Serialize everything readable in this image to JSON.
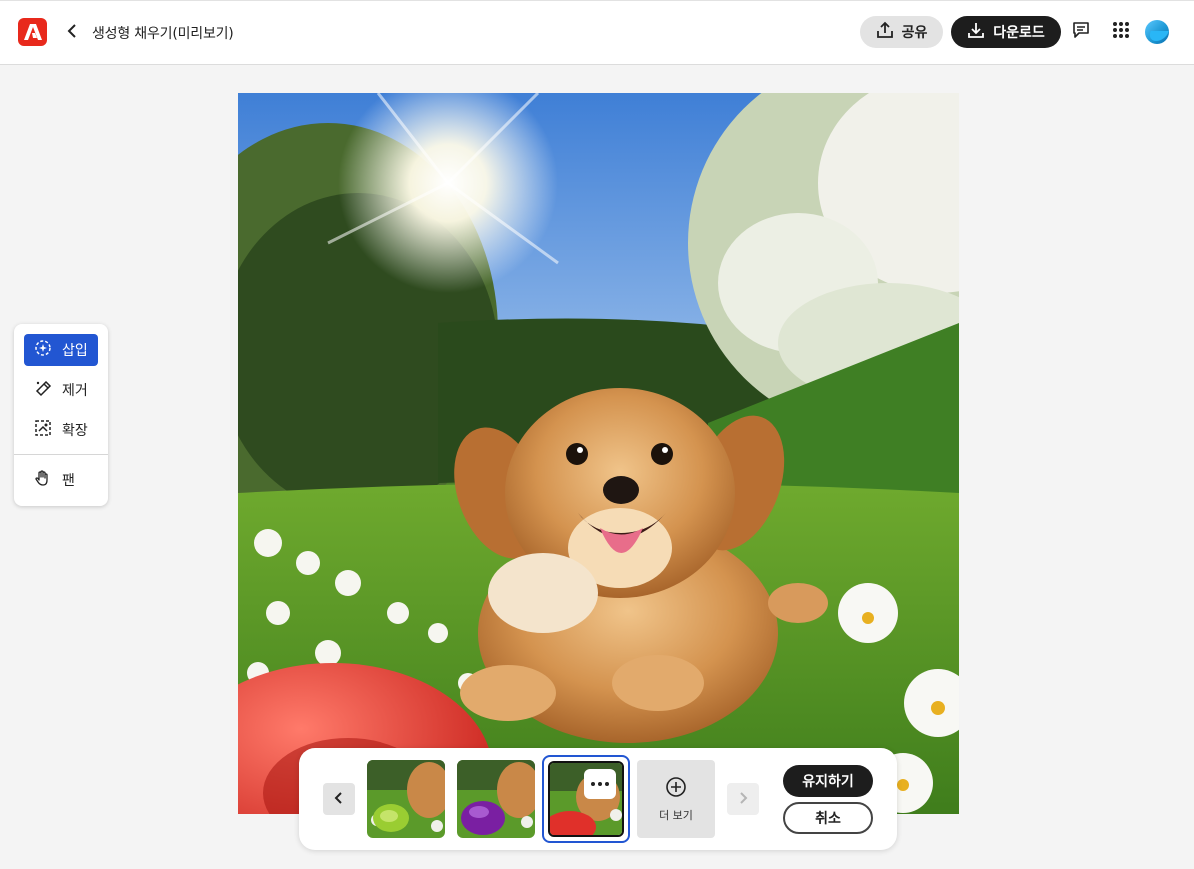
{
  "app": {
    "logo_icon": "adobe-logo-icon",
    "brand_color": "#e8291c"
  },
  "header": {
    "back_icon": "chevron-left-icon",
    "title": "생성형 채우기(미리보기)",
    "share_label": "공유",
    "download_label": "다운로드",
    "comment_icon": "comment-icon",
    "apps_icon": "app-grid-icon",
    "avatar_icon": "user-avatar"
  },
  "tools": {
    "items": [
      {
        "label": "삽입",
        "icon": "insert-sparkle-icon",
        "active": true
      },
      {
        "label": "제거",
        "icon": "eraser-icon",
        "active": false
      },
      {
        "label": "확장",
        "icon": "expand-icon",
        "active": false
      },
      {
        "label": "팬",
        "icon": "hand-pan-icon",
        "active": false
      }
    ],
    "accent_color": "#2256d2"
  },
  "variants": {
    "more_label": "더 보기",
    "keep_label": "유지하기",
    "cancel_label": "취소",
    "thumbnails": [
      {
        "toy_color": "#9acd32",
        "selected": false
      },
      {
        "toy_color": "#7a1fa2",
        "selected": false
      },
      {
        "toy_color": "#e0302a",
        "selected": true
      }
    ]
  }
}
